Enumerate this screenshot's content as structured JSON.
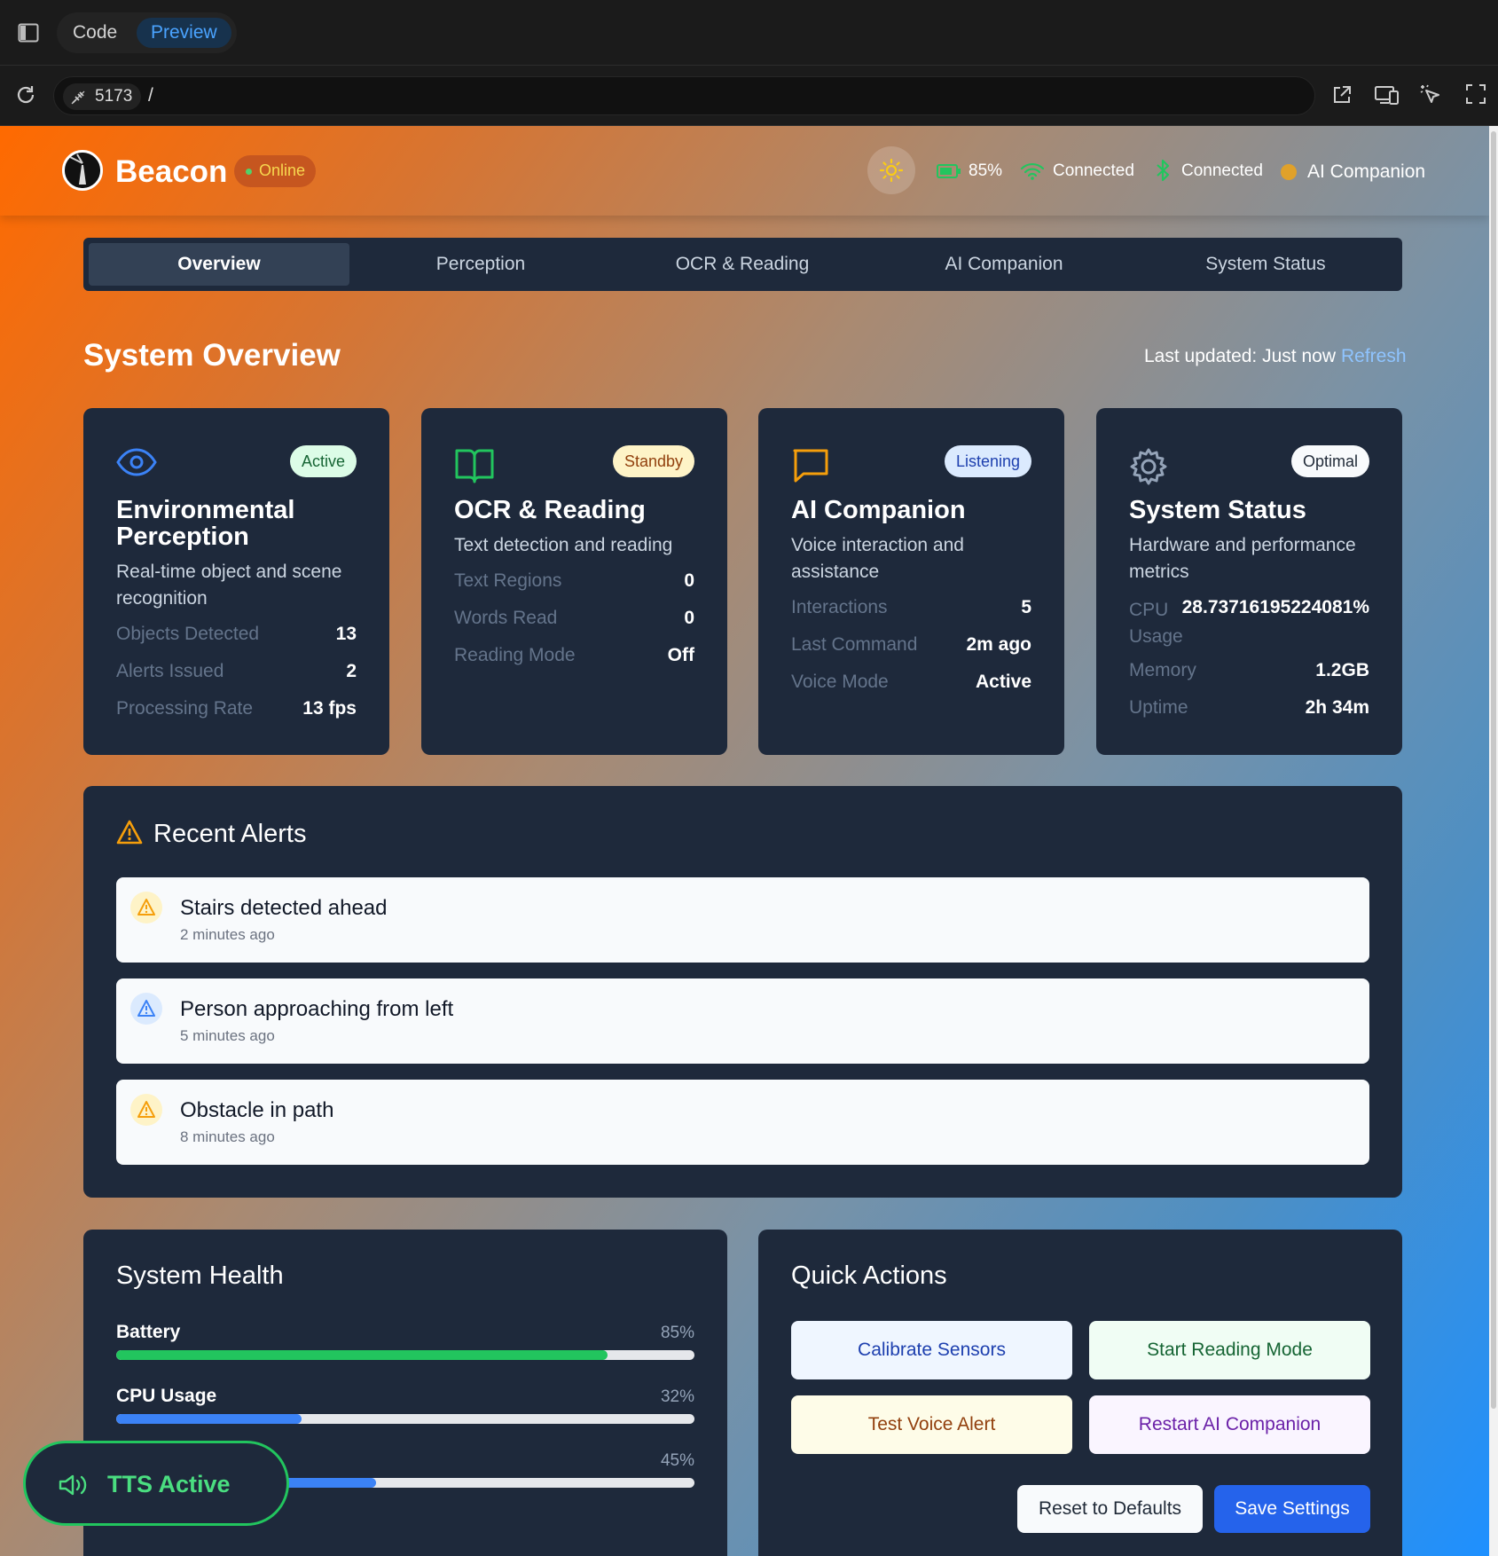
{
  "browser": {
    "tab_code": "Code",
    "tab_preview": "Preview",
    "port": "5173",
    "path": "/"
  },
  "header": {
    "brand": "Beacon",
    "status": "Online",
    "battery": "85%",
    "wifi": "Connected",
    "bluetooth": "Connected",
    "ai": "AI Companion"
  },
  "nav": {
    "tabs": [
      "Overview",
      "Perception",
      "OCR & Reading",
      "AI Companion",
      "System Status"
    ],
    "active": "Overview"
  },
  "overview": {
    "title": "System Overview",
    "last_updated": "Last updated: Just now",
    "refresh": "Refresh"
  },
  "cards": [
    {
      "icon": "eye-icon",
      "badge": "Active",
      "title": "Environmental Perception",
      "desc": "Real-time object and scene recognition",
      "rows": [
        {
          "k": "Objects Detected",
          "v": "13"
        },
        {
          "k": "Alerts Issued",
          "v": "2"
        },
        {
          "k": "Processing Rate",
          "v": "13 fps"
        }
      ]
    },
    {
      "icon": "book-icon",
      "badge": "Standby",
      "title": "OCR & Reading",
      "desc": "Text detection and reading",
      "rows": [
        {
          "k": "Text Regions",
          "v": "0"
        },
        {
          "k": "Words Read",
          "v": "0"
        },
        {
          "k": "Reading Mode",
          "v": "Off"
        }
      ]
    },
    {
      "icon": "chat-icon",
      "badge": "Listening",
      "title": "AI Companion",
      "desc": "Voice interaction and assistance",
      "rows": [
        {
          "k": "Interactions",
          "v": "5"
        },
        {
          "k": "Last Command",
          "v": "2m ago"
        },
        {
          "k": "Voice Mode",
          "v": "Active"
        }
      ]
    },
    {
      "icon": "gear-icon",
      "badge": "Optimal",
      "title": "System Status",
      "desc": "Hardware and performance metrics",
      "rows": [
        {
          "k": "CPU Usage",
          "v": "28.73716195224081%"
        },
        {
          "k": "Memory",
          "v": "1.2GB"
        },
        {
          "k": "Uptime",
          "v": "2h 34m"
        }
      ]
    }
  ],
  "alerts": {
    "title": "Recent Alerts",
    "items": [
      {
        "text": "Stairs detected ahead",
        "time": "2 minutes ago",
        "level": "warning"
      },
      {
        "text": "Person approaching from left",
        "time": "5 minutes ago",
        "level": "info"
      },
      {
        "text": "Obstacle in path",
        "time": "8 minutes ago",
        "level": "warning"
      }
    ]
  },
  "health": {
    "title": "System Health",
    "bars": [
      {
        "label": "Battery",
        "value": "85%",
        "fraction": 0.85,
        "color": "#22c55e"
      },
      {
        "label": "CPU Usage",
        "value": "32%",
        "fraction": 0.32,
        "color": "#3b82f6"
      },
      {
        "label": "",
        "value": "45%",
        "fraction": 0.45,
        "color": "#3b82f6"
      }
    ]
  },
  "quick_actions": {
    "title": "Quick Actions",
    "buttons": [
      "Calibrate Sensors",
      "Start Reading Mode",
      "Test Voice Alert",
      "Restart AI Companion"
    ],
    "reset": "Reset to Defaults",
    "save": "Save Settings"
  },
  "tts": {
    "label": "TTS Active"
  },
  "colors": {
    "card": "#1e293b",
    "accent_blue": "#3b82f6",
    "accent_green": "#22c55e",
    "warning": "#f59e0b"
  }
}
